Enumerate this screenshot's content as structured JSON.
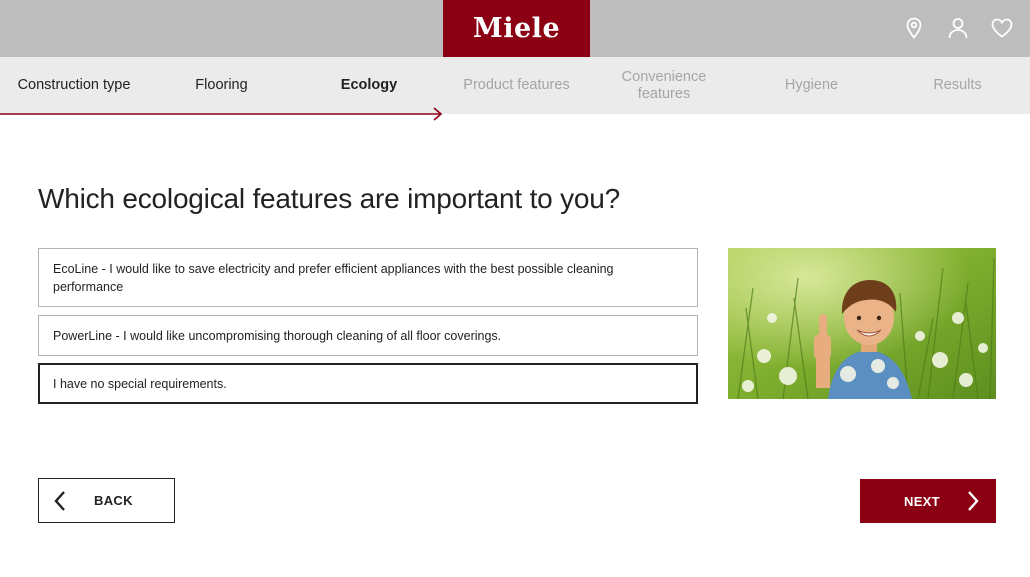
{
  "header": {
    "brand": "Miele",
    "icons": [
      "location-pin-icon",
      "user-icon",
      "heart-icon"
    ],
    "brand_color": "#8c0014"
  },
  "steps": [
    {
      "label": "Construction type",
      "state": "done"
    },
    {
      "label": "Flooring",
      "state": "done"
    },
    {
      "label": "Ecology",
      "state": "active"
    },
    {
      "label": "Product features",
      "state": "todo"
    },
    {
      "label": "Convenience features",
      "state": "todo"
    },
    {
      "label": "Hygiene",
      "state": "todo"
    },
    {
      "label": "Results",
      "state": "todo"
    }
  ],
  "question": "Which ecological features are important to you?",
  "options": [
    {
      "label": "EcoLine - I would like to save electricity and prefer efficient appliances with the best possible cleaning performance",
      "selected": false
    },
    {
      "label": "PowerLine - I would like uncompromising thorough cleaning of all floor coverings.",
      "selected": false
    },
    {
      "label": "I have no special requirements.",
      "selected": true
    }
  ],
  "navigation": {
    "back_label": "BACK",
    "next_label": "NEXT"
  }
}
